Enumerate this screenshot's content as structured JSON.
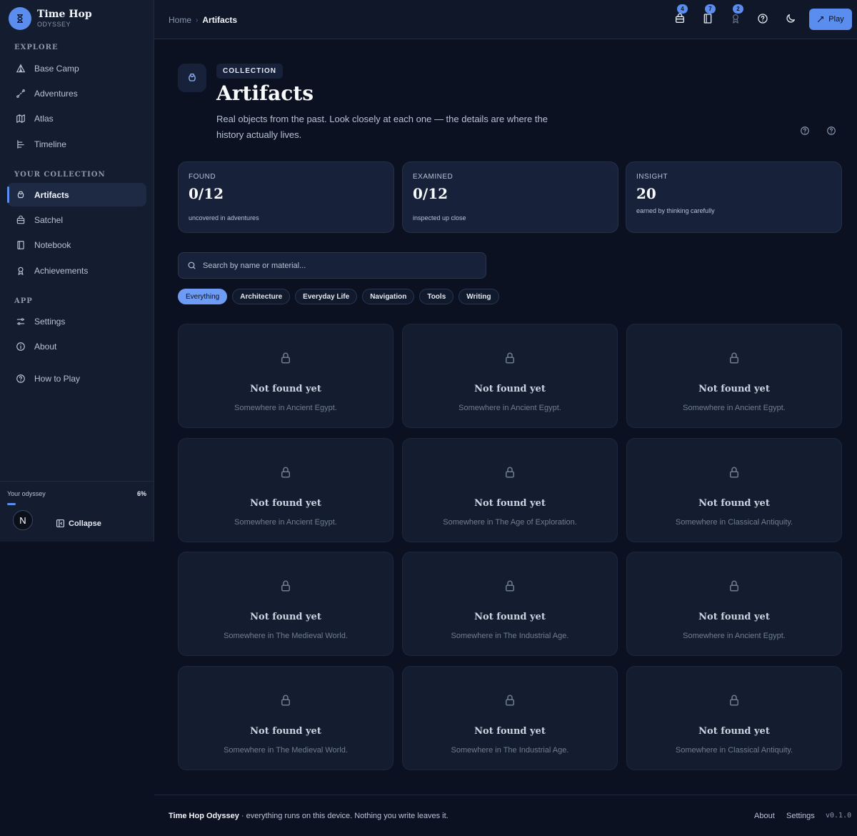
{
  "brand": {
    "title": "Time Hop",
    "subtitle": "ODYSSEY"
  },
  "sidebar": {
    "explore_label": "EXPLORE",
    "collection_label": "YOUR COLLECTION",
    "app_label": "APP",
    "items": [
      {
        "label": "Base Camp",
        "icon": "tent-icon"
      },
      {
        "label": "Adventures",
        "icon": "route-icon"
      },
      {
        "label": "Atlas",
        "icon": "map-icon"
      },
      {
        "label": "Timeline",
        "icon": "timeline-icon"
      },
      {
        "label": "Artifacts",
        "icon": "gem-icon",
        "active": true
      },
      {
        "label": "Satchel",
        "icon": "bag-icon"
      },
      {
        "label": "Notebook",
        "icon": "notebook-icon"
      },
      {
        "label": "Achievements",
        "icon": "award-icon"
      },
      {
        "label": "Settings",
        "icon": "sliders-icon"
      },
      {
        "label": "About",
        "icon": "info-icon"
      },
      {
        "label": "How to Play",
        "icon": "help-icon"
      }
    ],
    "odyssey_label": "Your odyssey",
    "odyssey_pct": "6%",
    "odyssey_progress": 0.06,
    "avatar_letter": "N",
    "collapse_label": "Collapse"
  },
  "topbar": {
    "crumb_home": "Home",
    "crumb_current": "Artifacts",
    "badges": {
      "satchel": "4",
      "notebook": "7",
      "achievements": "2"
    },
    "play_label": "Play"
  },
  "header": {
    "chip": "COLLECTION",
    "title": "Artifacts",
    "description": "Real objects from the past. Look closely at each one — the details are where the history actually lives."
  },
  "stats": [
    {
      "label": "FOUND",
      "value": "0/12",
      "sub": "uncovered in adventures"
    },
    {
      "label": "EXAMINED",
      "value": "0/12",
      "sub": "inspected up close"
    },
    {
      "label": "INSIGHT",
      "value": "20",
      "sub": "earned by thinking carefully"
    }
  ],
  "search": {
    "placeholder": "Search by name or material..."
  },
  "filters": [
    "Everything",
    "Architecture",
    "Everyday Life",
    "Navigation",
    "Tools",
    "Writing"
  ],
  "cards": [
    {
      "title": "Not found yet",
      "sub": "Somewhere in Ancient Egypt."
    },
    {
      "title": "Not found yet",
      "sub": "Somewhere in Ancient Egypt."
    },
    {
      "title": "Not found yet",
      "sub": "Somewhere in Ancient Egypt."
    },
    {
      "title": "Not found yet",
      "sub": "Somewhere in Ancient Egypt."
    },
    {
      "title": "Not found yet",
      "sub": "Somewhere in The Age of Exploration."
    },
    {
      "title": "Not found yet",
      "sub": "Somewhere in Classical Antiquity."
    },
    {
      "title": "Not found yet",
      "sub": "Somewhere in The Medieval World."
    },
    {
      "title": "Not found yet",
      "sub": "Somewhere in The Industrial Age."
    },
    {
      "title": "Not found yet",
      "sub": "Somewhere in Ancient Egypt."
    },
    {
      "title": "Not found yet",
      "sub": "Somewhere in The Medieval World."
    },
    {
      "title": "Not found yet",
      "sub": "Somewhere in The Industrial Age."
    },
    {
      "title": "Not found yet",
      "sub": "Somewhere in Classical Antiquity."
    }
  ],
  "footer": {
    "brand": "Time Hop Odyssey",
    "text": " · everything runs on this device. Nothing you write leaves it.",
    "about": "About",
    "settings": "Settings",
    "version": "v0.1.0"
  },
  "colors": {
    "accent": "#5b8def",
    "background": "#0b1120",
    "sidebar": "#141d30",
    "card": "#141d30"
  }
}
